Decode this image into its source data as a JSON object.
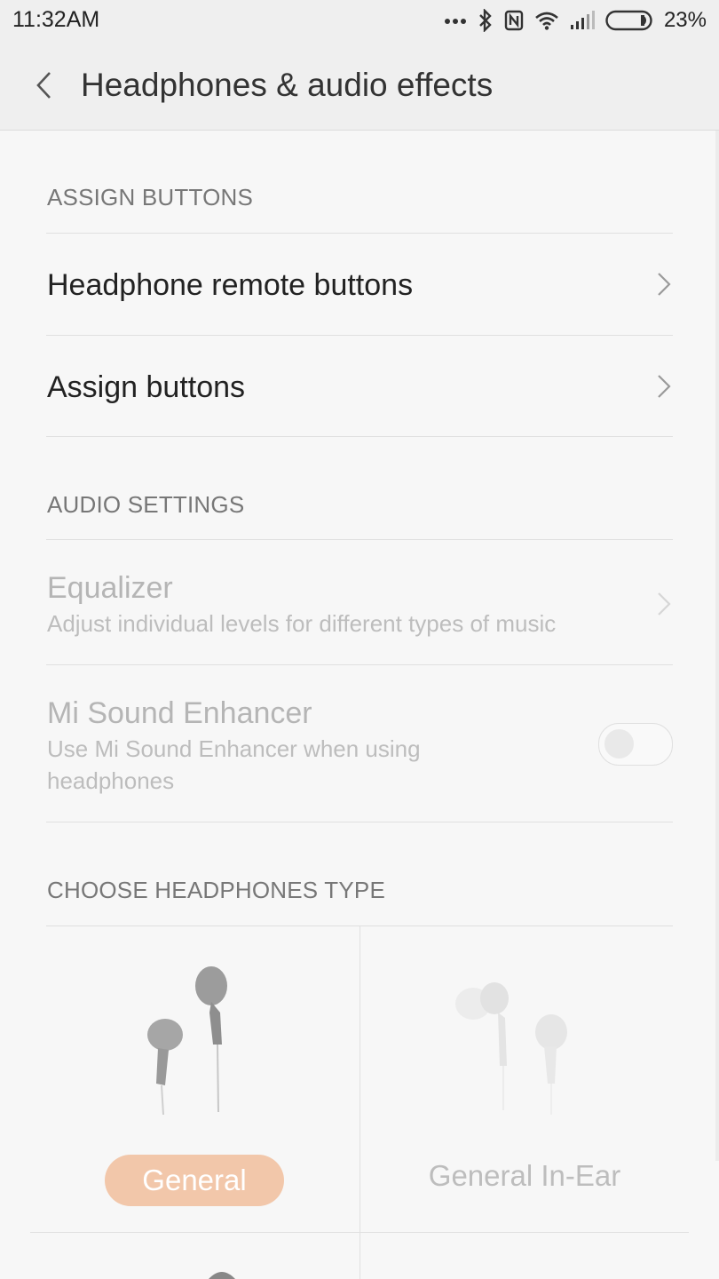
{
  "status_bar": {
    "time": "11:32AM",
    "battery_percent": "23%",
    "icons": [
      "more-dots-icon",
      "bluetooth-icon",
      "nfc-icon",
      "wifi-icon",
      "signal-icon",
      "battery-icon"
    ]
  },
  "header": {
    "title": "Headphones & audio effects",
    "back_icon": "chevron-left-icon"
  },
  "sections": {
    "assign": {
      "header": "ASSIGN BUTTONS",
      "items": [
        {
          "label": "Headphone remote buttons"
        },
        {
          "label": "Assign buttons"
        }
      ]
    },
    "audio": {
      "header": "AUDIO SETTINGS",
      "equalizer": {
        "label": "Equalizer",
        "subtitle": "Adjust individual levels for different types of music"
      },
      "enhancer": {
        "label": "Mi Sound Enhancer",
        "subtitle_line1": "Use Mi Sound Enhancer when using",
        "subtitle_line2": "headphones",
        "enabled": false
      }
    },
    "headphones_type": {
      "header": "CHOOSE HEADPHONES TYPE",
      "options": [
        {
          "label": "General",
          "selected": true
        },
        {
          "label": "General In-Ear",
          "selected": false
        }
      ]
    }
  },
  "colors": {
    "selected_pill": "#f2c7aa",
    "background": "#f7f7f7"
  }
}
